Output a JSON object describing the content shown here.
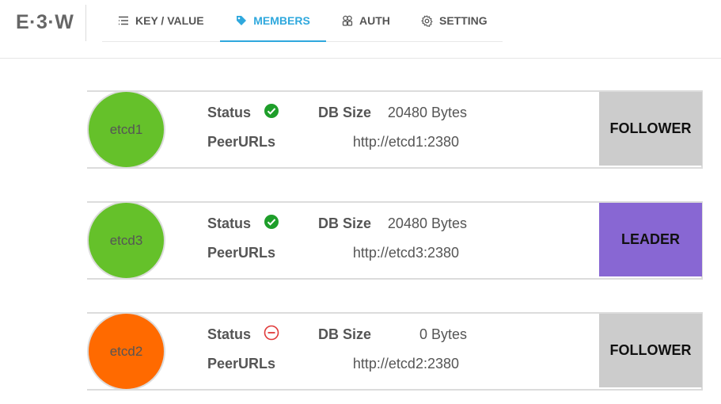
{
  "app": {
    "logo": "E·3·W"
  },
  "nav": {
    "tabs": [
      {
        "label": "KEY / VALUE",
        "icon": "list-icon"
      },
      {
        "label": "MEMBERS",
        "icon": "tag-icon",
        "active": true
      },
      {
        "label": "AUTH",
        "icon": "users-icon"
      },
      {
        "label": "SETTING",
        "icon": "gear-icon"
      }
    ]
  },
  "labels": {
    "status": "Status",
    "db_size": "DB Size",
    "peer_urls": "PeerURLs"
  },
  "members": [
    {
      "name": "etcd1",
      "status": "ok",
      "db_size": "20480 Bytes",
      "peer_url": "http://etcd1:2380",
      "role": "FOLLOWER",
      "circle_color": "#65c12a",
      "role_color": "#cccccc"
    },
    {
      "name": "etcd3",
      "status": "ok",
      "db_size": "20480 Bytes",
      "peer_url": "http://etcd3:2380",
      "role": "LEADER",
      "circle_color": "#65c12a",
      "role_color": "#8867d3"
    },
    {
      "name": "etcd2",
      "status": "error",
      "db_size": "0 Bytes",
      "peer_url": "http://etcd2:2380",
      "role": "FOLLOWER",
      "circle_color": "#ff6a00",
      "role_color": "#cccccc"
    }
  ],
  "colors": {
    "accent": "#2fa8dd",
    "ok": "#1e9e2a",
    "error": "#e03a3a"
  }
}
